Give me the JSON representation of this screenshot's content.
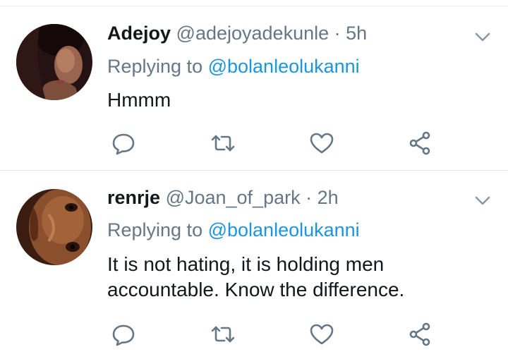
{
  "tweets": [
    {
      "name": "Adejoy",
      "handle": "@adejoyadekunle",
      "separator": "·",
      "time": "5h",
      "replying_prefix": "Replying to ",
      "replying_to": "@bolanleolukanni",
      "text": "Hmmm"
    },
    {
      "name": "renrje",
      "handle": "@Joan_of_park",
      "separator": "·",
      "time": "2h",
      "replying_prefix": "Replying to ",
      "replying_to": "@bolanleolukanni",
      "text": "It is not hating, it is holding men accountable. Know the difference."
    }
  ],
  "icons": {
    "reply": "reply-icon",
    "retweet": "retweet-icon",
    "like": "heart-icon",
    "share": "share-icon",
    "menu": "chevron-down-icon"
  },
  "colors": {
    "name": "#14171a",
    "meta": "#657786",
    "mention": "#1b95e0",
    "divider": "#e6ecf0"
  }
}
